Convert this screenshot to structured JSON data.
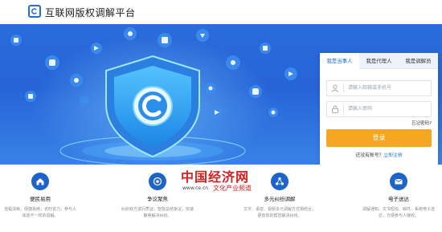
{
  "header": {
    "title": "互联网版权调解平台"
  },
  "login": {
    "tabs": [
      {
        "label": "我是当事人",
        "active": true
      },
      {
        "label": "我是代理人",
        "active": false
      },
      {
        "label": "我是调解员",
        "active": false
      }
    ],
    "account_placeholder": "请输入邮箱或手机号",
    "password_placeholder": "请输入密码",
    "forgot_label": "忘记密码?",
    "login_label": "登录",
    "register_prompt": "还没有账号？",
    "register_link": "立即注册"
  },
  "features": [
    {
      "title": "便民易用",
      "desc": "流程清晰，便捷易用，省时省力，参与人体验不一样的调解。",
      "icon": "house-icon"
    },
    {
      "title": "争议聚焦",
      "desc": "纠纷双方进行质证，智能总结争议，快速聚焦解决纠纷。",
      "icon": "target-icon"
    },
    {
      "title": "多元纠纷调解",
      "desc": "文字、语音、视频多元调解方式相结合，更有效的帮您解决纠纷。",
      "icon": "network-icon"
    },
    {
      "title": "电子送达",
      "desc": "调解通知、文书短信、邮件、系统电子送达，方便参与人接收。",
      "icon": "envelope-icon"
    }
  ],
  "watermark": {
    "brand": "中国经济网",
    "url": "www.ce.cn",
    "channel": "文化产业频道"
  },
  "colors": {
    "brand_blue": "#1e6fd9",
    "hero_blue": "#1d63d8",
    "login_orange": "#f5a623"
  }
}
